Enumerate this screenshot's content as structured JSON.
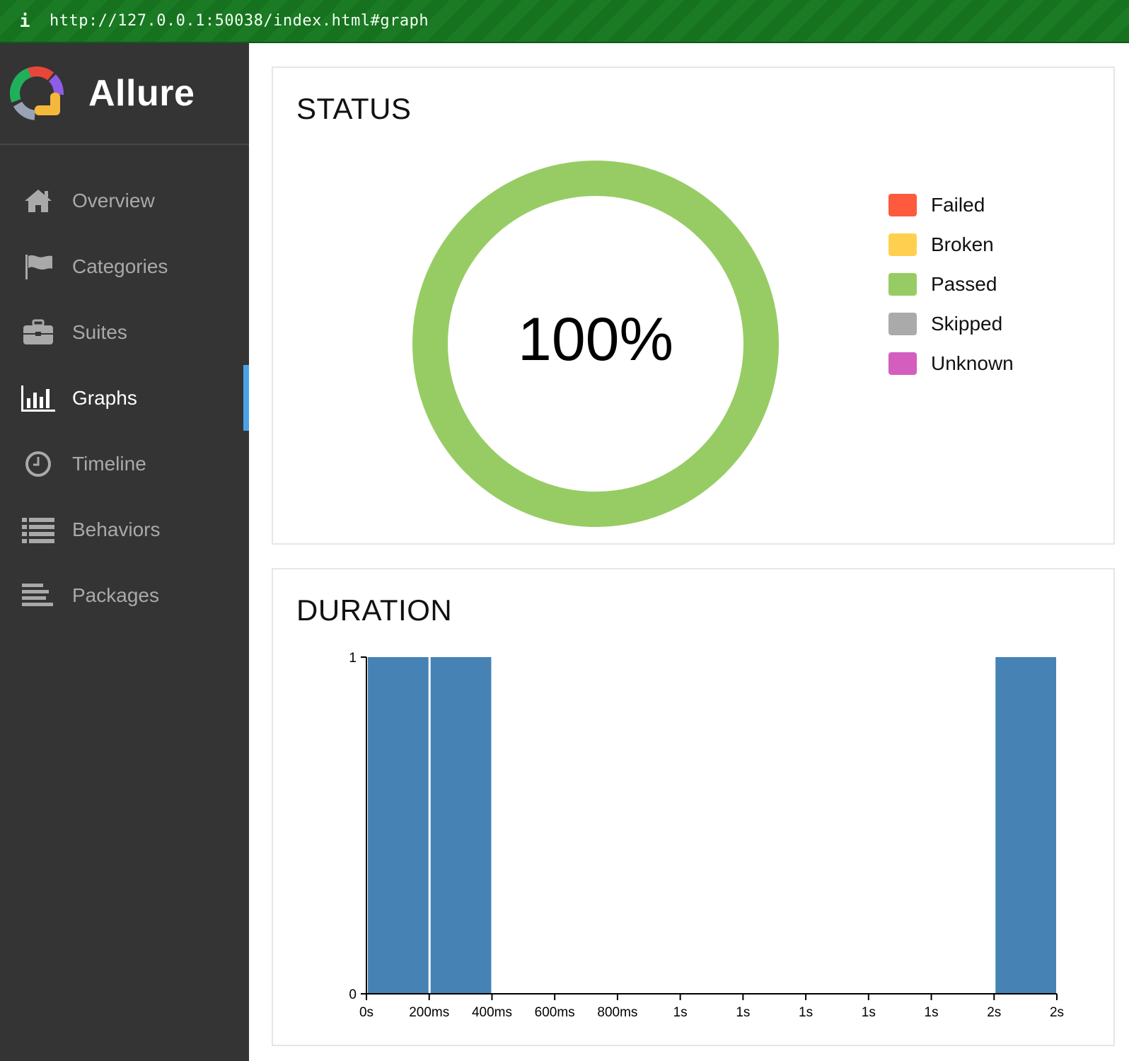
{
  "browser": {
    "info_icon": "i",
    "url": "http://127.0.0.1:50038/index.html#graph"
  },
  "sidebar": {
    "brand": "Allure",
    "items": [
      {
        "label": "Overview",
        "icon": "home-icon",
        "active": false
      },
      {
        "label": "Categories",
        "icon": "flag-icon",
        "active": false
      },
      {
        "label": "Suites",
        "icon": "briefcase-icon",
        "active": false
      },
      {
        "label": "Graphs",
        "icon": "bar-chart-icon",
        "active": true
      },
      {
        "label": "Timeline",
        "icon": "clock-icon",
        "active": false
      },
      {
        "label": "Behaviors",
        "icon": "list-icon",
        "active": false
      },
      {
        "label": "Packages",
        "icon": "align-left-icon",
        "active": false
      }
    ]
  },
  "status": {
    "title": "STATUS",
    "percent_label": "100%",
    "passed_fraction": 1.0,
    "ring_color": "#97cc64",
    "legend": [
      {
        "label": "Failed",
        "color": "#fd5a3e"
      },
      {
        "label": "Broken",
        "color": "#ffd050"
      },
      {
        "label": "Passed",
        "color": "#97cc64"
      },
      {
        "label": "Skipped",
        "color": "#aaaaaa"
      },
      {
        "label": "Unknown",
        "color": "#d35ebe"
      }
    ]
  },
  "duration": {
    "title": "DURATION"
  },
  "chart_data": {
    "type": "bar",
    "title": "DURATION",
    "bar_color": "#4682b4",
    "xlim": [
      0,
      2.2
    ],
    "ylim": [
      0,
      1
    ],
    "y_ticks": [
      "0",
      "1"
    ],
    "x_tick_values": [
      0,
      0.2,
      0.4,
      0.6,
      0.8,
      1.0,
      1.2,
      1.4,
      1.6,
      1.8,
      2.0,
      2.2
    ],
    "x_tick_labels": [
      "0s",
      "200ms",
      "400ms",
      "600ms",
      "800ms",
      "1s",
      "1s",
      "1s",
      "1s",
      "1s",
      "2s",
      "2s"
    ],
    "bins": [
      {
        "x0": 0.0,
        "x1": 0.2,
        "count": 1
      },
      {
        "x0": 0.2,
        "x1": 0.4,
        "count": 1
      },
      {
        "x0": 2.0,
        "x1": 2.2,
        "count": 1
      }
    ]
  }
}
